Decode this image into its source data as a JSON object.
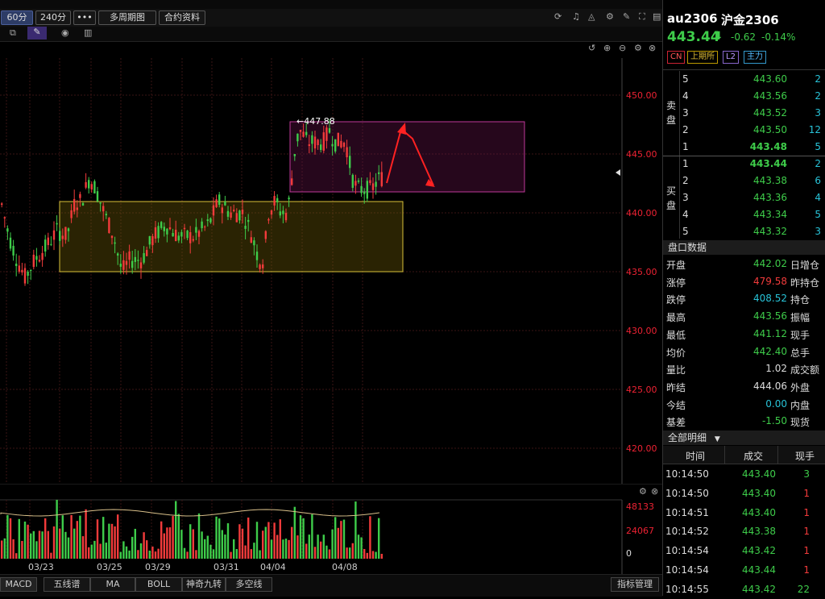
{
  "toolbar": {
    "periods": [
      "60分",
      "240分"
    ],
    "more_label": "•••",
    "multi_period_label": "多周期图",
    "contract_info_label": "合约资料"
  },
  "price_axis": {
    "ticks": [
      "450.00",
      "445.00",
      "440.00",
      "435.00",
      "430.00",
      "425.00",
      "420.00"
    ]
  },
  "date_axis": {
    "ticks": [
      "03/23",
      "03/25",
      "03/29",
      "03/31",
      "04/04",
      "04/08"
    ]
  },
  "annotation": {
    "high_label": "←447.88"
  },
  "volume_axis": {
    "ticks": [
      "48133",
      "24067",
      "0"
    ]
  },
  "indicator_tabs": [
    "MACD",
    "五线谱",
    "MA",
    "BOLL",
    "神奇九转",
    "多空线"
  ],
  "indicator_manage_label": "指标管理",
  "quote": {
    "code": "au2306",
    "name": "沪金2306",
    "price": "443.44",
    "change": "-0.62",
    "change_pct": "-0.14%",
    "tags": [
      "CN",
      "上期所",
      "L2",
      "主力"
    ]
  },
  "order_book": {
    "sell_label": "卖盘",
    "buy_label": "买盘",
    "asks": [
      {
        "level": "5",
        "price": "443.60",
        "qty": "2"
      },
      {
        "level": "4",
        "price": "443.56",
        "qty": "2"
      },
      {
        "level": "3",
        "price": "443.52",
        "qty": "3"
      },
      {
        "level": "2",
        "price": "443.50",
        "qty": "12"
      },
      {
        "level": "1",
        "price": "443.48",
        "qty": "5"
      }
    ],
    "bids": [
      {
        "level": "1",
        "price": "443.44",
        "qty": "2"
      },
      {
        "level": "2",
        "price": "443.38",
        "qty": "6"
      },
      {
        "level": "3",
        "price": "443.36",
        "qty": "4"
      },
      {
        "level": "4",
        "price": "443.34",
        "qty": "5"
      },
      {
        "level": "5",
        "price": "443.32",
        "qty": "3"
      }
    ]
  },
  "market_data": {
    "title": "盘口数据",
    "rows": [
      {
        "label": "开盘",
        "value": "442.02",
        "right": "日增仓"
      },
      {
        "label": "涨停",
        "value": "479.58",
        "right": "昨持仓"
      },
      {
        "label": "跌停",
        "value": "408.52",
        "right": "持仓"
      },
      {
        "label": "最高",
        "value": "443.56",
        "right": "振幅"
      },
      {
        "label": "最低",
        "value": "441.12",
        "right": "现手"
      },
      {
        "label": "均价",
        "value": "442.40",
        "right": "总手"
      },
      {
        "label": "量比",
        "value": "1.02",
        "right": "成交额"
      },
      {
        "label": "昨结",
        "value": "444.06",
        "right": "外盘"
      },
      {
        "label": "今结",
        "value": "0.00",
        "right": "内盘"
      },
      {
        "label": "基差",
        "value": "-1.50",
        "right": "现货"
      }
    ]
  },
  "trades": {
    "title": "全部明细",
    "headers": [
      "时间",
      "成交",
      "现手"
    ],
    "rows": [
      {
        "time": "10:14:50",
        "price": "443.40",
        "qty": "3"
      },
      {
        "time": "10:14:50",
        "price": "443.40",
        "qty": "1"
      },
      {
        "time": "10:14:51",
        "price": "443.40",
        "qty": "1"
      },
      {
        "time": "10:14:52",
        "price": "443.38",
        "qty": "1"
      },
      {
        "time": "10:14:54",
        "price": "443.42",
        "qty": "1"
      },
      {
        "time": "10:14:54",
        "price": "443.44",
        "qty": "1"
      },
      {
        "time": "10:14:55",
        "price": "443.42",
        "qty": "22"
      }
    ]
  },
  "colors": {
    "up": "#f23b3b",
    "down": "#3ecc4a",
    "accent": "#2d3c66",
    "box_yellow": "#d9c23a",
    "box_pink": "#c0399a"
  }
}
